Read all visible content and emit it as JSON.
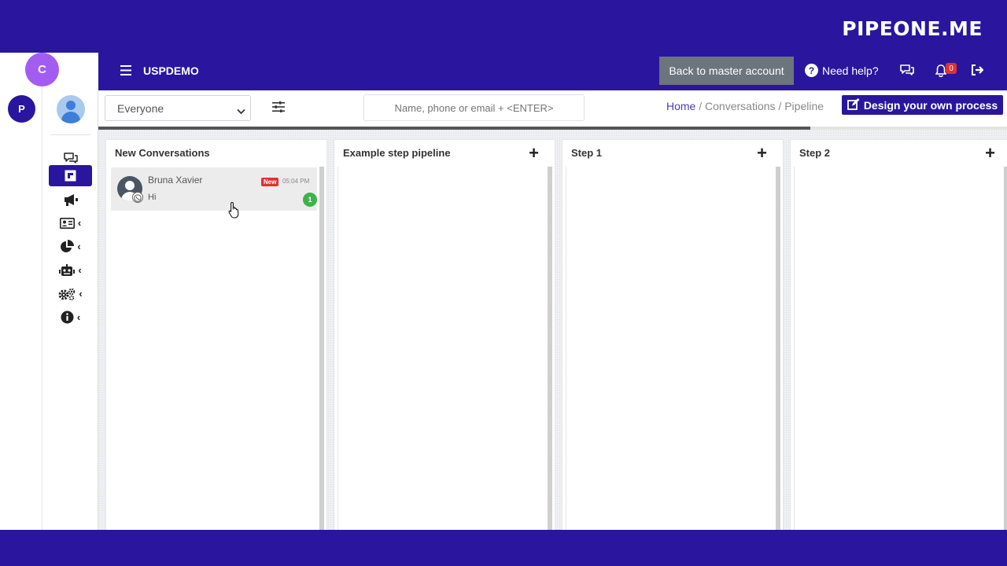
{
  "brand": {
    "logo_text": "PIPEONE.ME"
  },
  "rail": {
    "workspace_initial": "P",
    "corner_initial": "C"
  },
  "topbar": {
    "account_name": "USPDEMO",
    "master_button": "Back to master account",
    "help_label": "Need help?",
    "notification_count": "0"
  },
  "filters": {
    "selected_user": "Everyone",
    "search_placeholder": "Name, phone or email + <ENTER>",
    "breadcrumb": {
      "home": "Home",
      "sep1": " / ",
      "conversations": "Conversations",
      "sep2": " / ",
      "current": "Pipeline"
    },
    "design_button": "Design your own process"
  },
  "board": {
    "columns": [
      {
        "title": "New Conversations",
        "has_add": false
      },
      {
        "title": "Example step pipeline",
        "has_add": true
      },
      {
        "title": "Step 1",
        "has_add": true
      },
      {
        "title": "Step 2",
        "has_add": true
      }
    ],
    "cards": [
      {
        "name": "Bruna Xavier",
        "message": "Hi",
        "badge": "New",
        "time": "05:04 PM",
        "unread": "1",
        "channel_icon": "whatsapp-icon"
      }
    ]
  },
  "colors": {
    "brand": "#2a169e",
    "accent_purple": "#a35cf0",
    "badge_red": "#e03131",
    "unread_green": "#3cb44b",
    "master_btn": "#6c757d"
  }
}
